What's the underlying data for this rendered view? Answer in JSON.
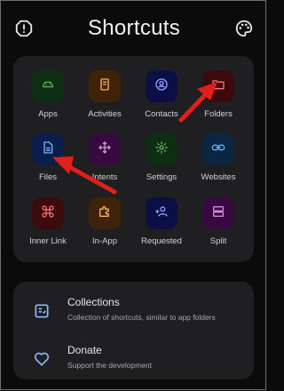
{
  "header": {
    "title": "Shortcuts",
    "left_icon": "info-icon",
    "right_icon": "palette-icon"
  },
  "tiles": [
    {
      "label": "Apps",
      "icon": "android-icon",
      "bg": "#0e2e16",
      "fg": "#4caf50"
    },
    {
      "label": "Activities",
      "icon": "book-icon",
      "bg": "#3e2308",
      "fg": "#ffb74d"
    },
    {
      "label": "Contacts",
      "icon": "contact-icon",
      "bg": "#0c0f45",
      "fg": "#8fa3ff"
    },
    {
      "label": "Folders",
      "icon": "folder-icon",
      "bg": "#3b0a0c",
      "fg": "#ff6f6f"
    },
    {
      "label": "Files",
      "icon": "file-icon",
      "bg": "#0b1d4a",
      "fg": "#82b1ff"
    },
    {
      "label": "Intents",
      "icon": "move-icon",
      "bg": "#36093f",
      "fg": "#ce93d8"
    },
    {
      "label": "Settings",
      "icon": "gear-icon",
      "bg": "#0d2e12",
      "fg": "#66bb6a"
    },
    {
      "label": "Websites",
      "icon": "link-icon",
      "bg": "#0a2640",
      "fg": "#64b5f6"
    },
    {
      "label": "Inner Link",
      "icon": "command-icon",
      "bg": "#3b0b0d",
      "fg": "#ff7777"
    },
    {
      "label": "In-App",
      "icon": "puzzle-icon",
      "bg": "#3e2308",
      "fg": "#ffb74d"
    },
    {
      "label": "Requested",
      "icon": "add-user-icon",
      "bg": "#0c0f45",
      "fg": "#8fa3ff"
    },
    {
      "label": "Split",
      "icon": "split-icon",
      "bg": "#36093f",
      "fg": "#d58be3"
    }
  ],
  "rows": [
    {
      "title": "Collections",
      "subtitle": "Collection of shortcuts, similar to app folders",
      "icon": "collection-icon"
    },
    {
      "title": "Donate",
      "subtitle": "Support the development",
      "icon": "heart-icon"
    }
  ],
  "colors": {
    "annotation_arrow": "#e0201b",
    "accent": "#8fb6ff"
  }
}
